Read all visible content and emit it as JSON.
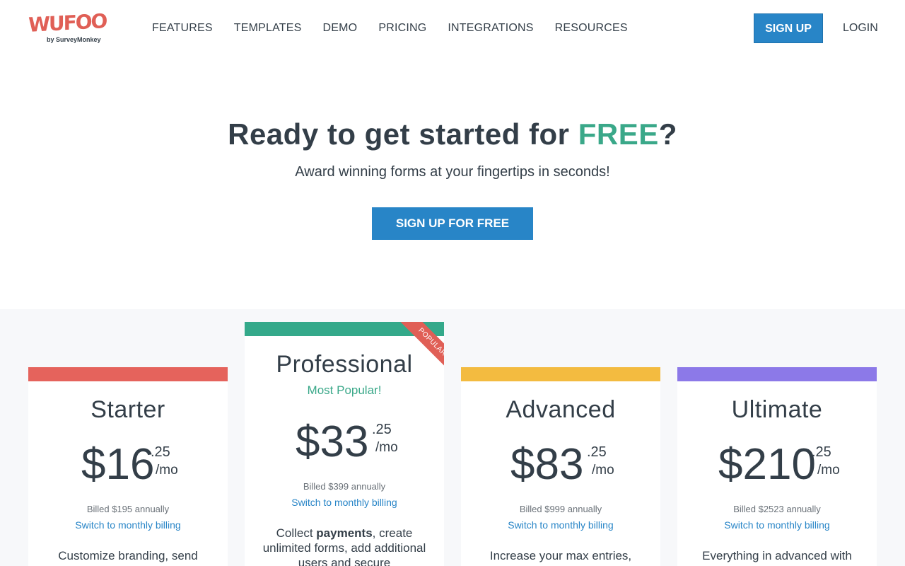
{
  "brand": {
    "logo_text": "WUFOO",
    "logo_sub": "by SurveyMonkey",
    "accent_red": "#e05f56",
    "accent_green": "#3aa889",
    "accent_blue": "#2885c7"
  },
  "nav": {
    "items": [
      {
        "label": "FEATURES"
      },
      {
        "label": "TEMPLATES"
      },
      {
        "label": "DEMO"
      },
      {
        "label": "PRICING"
      },
      {
        "label": "INTEGRATIONS"
      },
      {
        "label": "RESOURCES"
      }
    ],
    "signup_label": "SIGN UP",
    "login_label": "LOGIN"
  },
  "hero": {
    "title_prefix": "Ready to get started for ",
    "title_accent": "FREE",
    "title_suffix": "?",
    "subtitle": "Award winning forms at your fingertips in seconds!",
    "cta_label": "SIGN UP FOR FREE"
  },
  "plans": [
    {
      "name": "Starter",
      "color": "#e5635c",
      "price": "$16",
      "cents": ".25",
      "per": "/mo",
      "billed": "Billed $195 annually",
      "switch": "Switch to monthly billing",
      "desc": "Customize branding, send"
    },
    {
      "name": "Professional",
      "color": "#34a98a",
      "tagline": "Most Popular!",
      "ribbon": "POPULAR",
      "price": "$33",
      "cents": ".25",
      "per": "/mo",
      "billed": "Billed $399 annually",
      "switch": "Switch to monthly billing",
      "desc_pre": "Collect ",
      "desc_bold": "payments",
      "desc_post": ", create unlimited forms, add additional users and secure"
    },
    {
      "name": "Advanced",
      "color": "#f3bb40",
      "price": "$83",
      "cents": ".25",
      "per": "/mo",
      "billed": "Billed $999 annually",
      "switch": "Switch to monthly billing",
      "desc": "Increase your max entries,"
    },
    {
      "name": "Ultimate",
      "color": "#8c79e8",
      "price": "$210",
      "cents": ".25",
      "per": "/mo",
      "billed": "Billed $2523 annually",
      "switch": "Switch to monthly billing",
      "desc": "Everything in advanced with"
    }
  ]
}
